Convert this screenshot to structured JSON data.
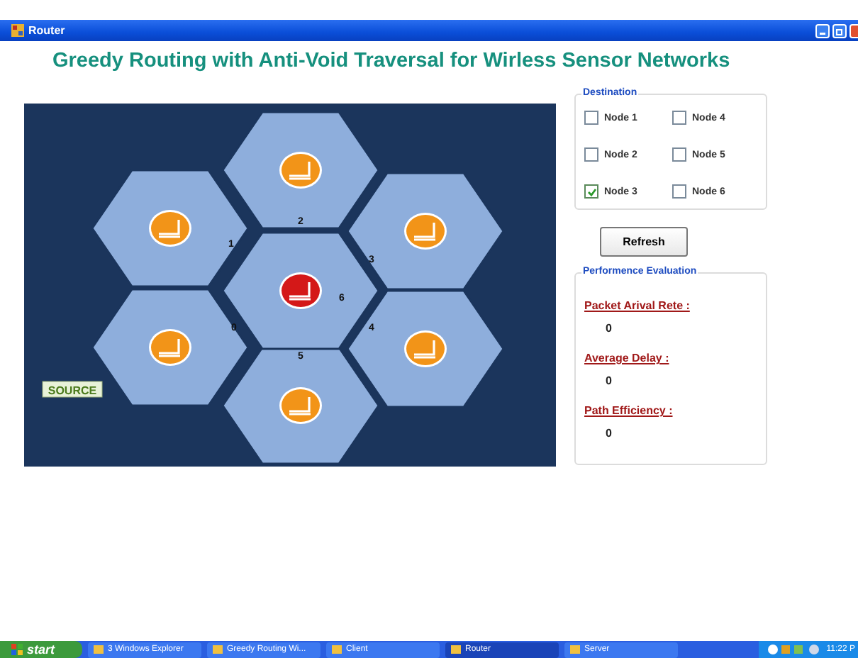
{
  "window": {
    "title": "Router"
  },
  "heading": "Greedy Routing with Anti-Void Traversal for Wirless Sensor Networks",
  "network": {
    "nodes": [
      {
        "label": "0",
        "highlighted": false
      },
      {
        "label": "1",
        "highlighted": false
      },
      {
        "label": "2",
        "highlighted": false
      },
      {
        "label": "3",
        "highlighted": false
      },
      {
        "label": "4",
        "highlighted": false
      },
      {
        "label": "5",
        "highlighted": false
      },
      {
        "label": "6",
        "highlighted": true
      }
    ],
    "source_label": "SOURCE"
  },
  "destination": {
    "title": "Destination",
    "checkboxes": [
      {
        "label": "Node 1",
        "checked": false
      },
      {
        "label": "Node 4",
        "checked": false
      },
      {
        "label": "Node 2",
        "checked": false
      },
      {
        "label": "Node 5",
        "checked": false
      },
      {
        "label": "Node 3",
        "checked": true
      },
      {
        "label": "Node 6",
        "checked": false
      }
    ]
  },
  "refresh_button": "Refresh",
  "performance": {
    "title": "Performence Evaluation",
    "metrics": [
      {
        "label": "Packet Arival Rete :",
        "value": "0"
      },
      {
        "label": "Average Delay :",
        "value": "0"
      },
      {
        "label": "Path Efficiency :",
        "value": "0"
      }
    ]
  },
  "taskbar": {
    "start": "start",
    "items": [
      {
        "label": "3 Windows Explorer",
        "selected": false
      },
      {
        "label": "Greedy Routing Wi...",
        "selected": false
      },
      {
        "label": "Client",
        "selected": false
      },
      {
        "label": "Router",
        "selected": true
      },
      {
        "label": "Server",
        "selected": false
      }
    ],
    "clock": "11:22 P"
  }
}
